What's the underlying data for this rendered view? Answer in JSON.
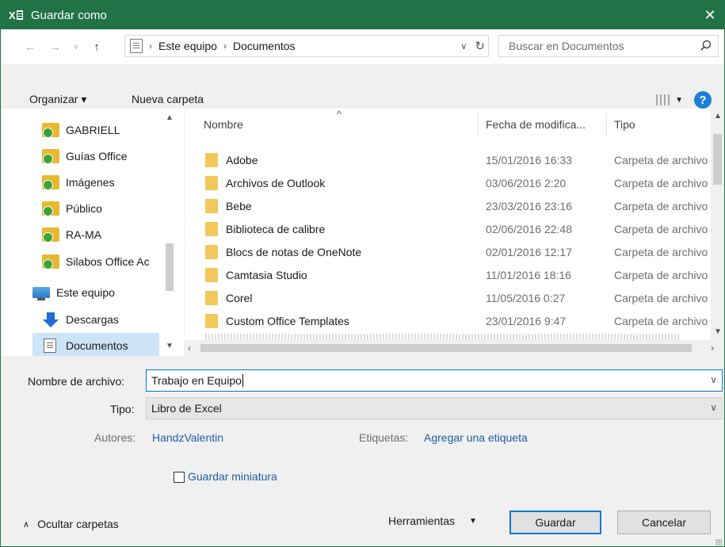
{
  "window": {
    "title": "Guardar como",
    "app_icon": "excel-icon",
    "close_label": "✕"
  },
  "address": {
    "breadcrumbs": [
      "Este equipo",
      "Documentos"
    ],
    "search_placeholder": "Buscar en Documentos"
  },
  "toolbar": {
    "organize_label": "Organizar ▾",
    "new_folder_label": "Nueva carpeta",
    "help_label": "?"
  },
  "nav": {
    "items": [
      {
        "label": "GABRIELL",
        "icon": "onedrive-folder-icon"
      },
      {
        "label": "Guías Office",
        "icon": "onedrive-shared-folder-icon"
      },
      {
        "label": "Imágenes",
        "icon": "onedrive-folder-icon"
      },
      {
        "label": "Público",
        "icon": "onedrive-shared-folder-icon"
      },
      {
        "label": "RA-MA",
        "icon": "onedrive-shared-folder-icon"
      },
      {
        "label": "Silabos Office Ac",
        "icon": "onedrive-shared-folder-icon"
      },
      {
        "label": "Este equipo",
        "icon": "computer-icon"
      },
      {
        "label": "Descargas",
        "icon": "download-icon"
      },
      {
        "label": "Documentos",
        "icon": "documents-icon",
        "selected": true
      }
    ]
  },
  "files": {
    "headers": {
      "name": "Nombre",
      "date": "Fecha de modifica...",
      "type": "Tipo"
    },
    "rows": [
      {
        "name": "Adobe",
        "date": "15/01/2016 16:33",
        "type": "Carpeta de archivos"
      },
      {
        "name": "Archivos de Outlook",
        "date": "03/06/2016 2:20",
        "type": "Carpeta de archivos"
      },
      {
        "name": "Bebe",
        "date": "23/03/2016 23:16",
        "type": "Carpeta de archivos"
      },
      {
        "name": "Biblioteca de calibre",
        "date": "02/06/2016 22:48",
        "type": "Carpeta de archivos"
      },
      {
        "name": "Blocs de notas de OneNote",
        "date": "02/01/2016 12:17",
        "type": "Carpeta de archivos"
      },
      {
        "name": "Camtasia Studio",
        "date": "11/01/2016 18:16",
        "type": "Carpeta de archivos"
      },
      {
        "name": "Corel",
        "date": "11/05/2016 0:27",
        "type": "Carpeta de archivos"
      },
      {
        "name": "Custom Office Templates",
        "date": "23/01/2016 9:47",
        "type": "Carpeta de archivos"
      }
    ]
  },
  "form": {
    "filename_label": "Nombre de archivo:",
    "filename_value": "Trabajo en Equipo",
    "type_label": "Tipo:",
    "type_value": "Libro de Excel",
    "authors_label": "Autores:",
    "authors_value": "HandzValentin",
    "tags_label": "Etiquetas:",
    "tags_value": "Agregar una etiqueta",
    "thumbnail_label": "Guardar miniatura",
    "tools_label": "Herramientas",
    "save_label": "Guardar",
    "cancel_label": "Cancelar",
    "hide_folders_label": "Ocultar carpetas"
  }
}
